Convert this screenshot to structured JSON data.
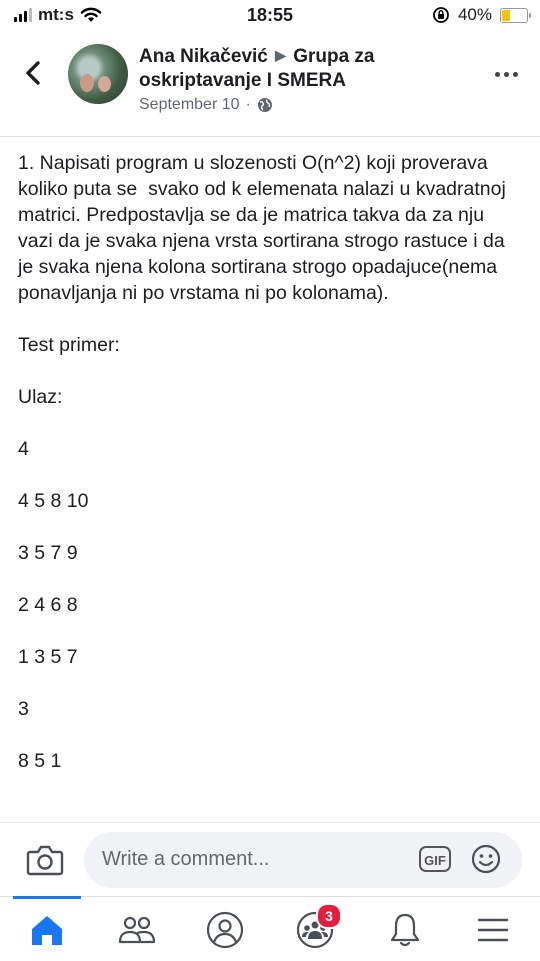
{
  "status_bar": {
    "carrier": "mt:s",
    "time": "18:55",
    "battery_percent": "40%",
    "battery_level": 0.4
  },
  "header": {
    "author": "Ana Nikačević",
    "group": "Grupa za oskriptavanje I SMERA",
    "date": "September 10",
    "separator": "·",
    "privacy_icon": "globe-icon"
  },
  "post": {
    "paragraphs": [
      "1. Napisati program u slozenosti O(n^2) koji proverava koliko puta se  svako od k elemenata nalazi u kvadratnoj matrici. Predpostavlja se da je matrica takva da za nju vazi da je svaka njena vrsta sortirana strogo rastuce i da je svaka njena kolona sortirana strogo opadajuce(nema ponavljanja ni po vrstama ni po kolonama).",
      "Test primer:",
      "Ulaz:",
      "4",
      "4 5 8 10",
      "3 5 7 9",
      "2 4 6 8",
      "1 3 5 7",
      "3",
      "8 5 1"
    ]
  },
  "comment_bar": {
    "placeholder": "Write a comment...",
    "gif_label": "GIF"
  },
  "tab_bar": {
    "items": [
      "home-icon",
      "friends-icon",
      "profile-icon",
      "groups-icon",
      "notifications-icon",
      "menu-icon"
    ],
    "groups_badge": "3",
    "accent": "#1877f2"
  }
}
